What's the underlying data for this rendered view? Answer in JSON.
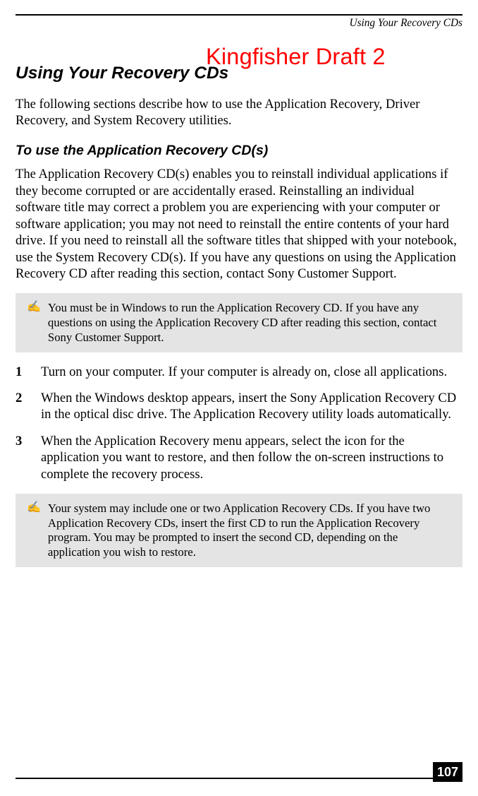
{
  "running_head": "Using Your Recovery CDs",
  "watermark": "Kingfisher Draft 2",
  "section_title": "Using Your Recovery CDs",
  "intro": "The following sections describe how to use the Application Recovery, Driver Recovery, and System Recovery utilities.",
  "subsection_title": "To use the Application Recovery CD(s)",
  "subsection_body": "The Application Recovery CD(s) enables you to reinstall individual applications if they become corrupted or are accidentally erased. Reinstalling an individual software title may correct a problem you are experiencing with your computer or software application; you may not need to reinstall the entire contents of your hard drive. If you need to reinstall all the software titles that shipped with your notebook, use the System Recovery CD(s). If you have any questions on using the Application Recovery CD after reading this section, contact Sony Customer Support.",
  "note1": "You must be in Windows to run the Application Recovery CD. If you have any questions on using the Application Recovery CD after reading this section, contact Sony Customer Support.",
  "steps": [
    {
      "num": "1",
      "text": "Turn on your computer. If your computer is already on, close all applications."
    },
    {
      "num": "2",
      "text": "When the Windows desktop appears, insert the Sony Application Recovery CD in the optical disc drive. The Application Recovery utility loads automatically."
    },
    {
      "num": "3",
      "text": "When the Application Recovery menu appears, select the icon for the application you want to restore, and then follow the on-screen instructions to complete the recovery process."
    }
  ],
  "note2": "Your system may include one or two Application Recovery CDs. If you have two Application Recovery CDs, insert the first CD to run the Application Recovery program. You may be prompted to insert the second CD, depending on the application you wish to restore.",
  "note_icon": "✍",
  "page_number": "107"
}
